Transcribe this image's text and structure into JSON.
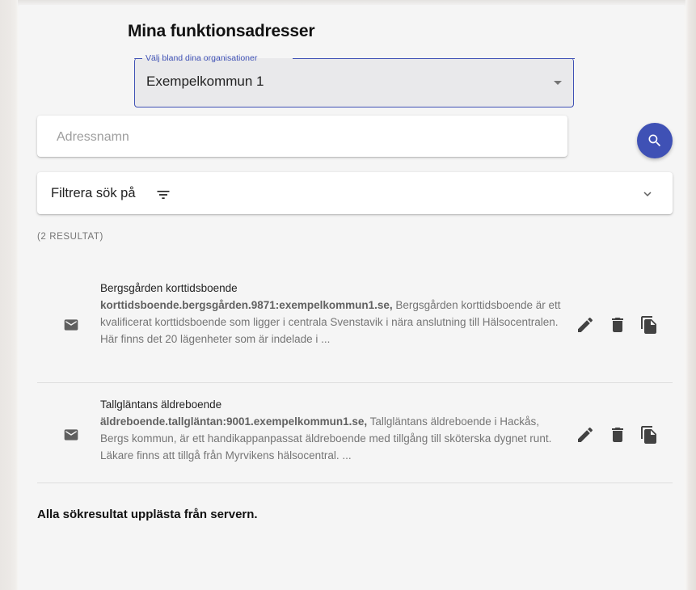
{
  "page": {
    "title": "Mina funktionsadresser"
  },
  "org_select": {
    "label": "Välj bland dina organisationer",
    "value": "Exempelkommun 1"
  },
  "search": {
    "placeholder": "Adressnamn",
    "value": ""
  },
  "filter": {
    "label": "Filtrera sök på"
  },
  "results": {
    "count_label": "(2 RESULTAT)",
    "items": [
      {
        "title": "Bergsgården korttidsboende",
        "address": "korttidsboende.bergsgården.9871:exempelkommun1.se,",
        "description": " Bergsgården korttidsboende är ett kvalificerat korttidsboende som ligger i centrala Svenstavik i nära anslutning till Hälsocentralen. Här finns det 20 lägenheter som är indelade i ..."
      },
      {
        "title": "Tallgläntans äldreboende",
        "address": "äldreboende.tallgläntan:9001.exempelkommun1.se,",
        "description": " Tallgläntans äldreboende i Hackås, Bergs kommun, är ett handikappanpassat äldreboende med tillgång till sköterska dygnet runt. Läkare finns att tillgå från Myrvikens hälsocentral. ..."
      }
    ]
  },
  "footer": {
    "message": "Alla sökresultat upplästa från servern."
  },
  "icons": {
    "search": "search-icon",
    "filter": "filter-list-icon",
    "expand": "chevron-down-icon",
    "mail": "mail-icon",
    "edit": "pencil-icon",
    "delete": "trash-icon",
    "copy": "copy-icon"
  },
  "colors": {
    "primary": "#3f51b5",
    "background": "#f5f5f5",
    "icon": "#424242"
  }
}
